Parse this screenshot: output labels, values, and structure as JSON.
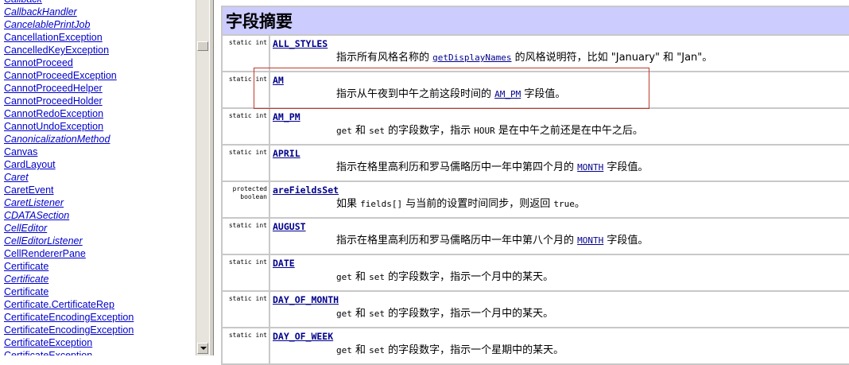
{
  "class_list": [
    {
      "label": "Callback",
      "italic": true
    },
    {
      "label": "CallbackHandler",
      "italic": true
    },
    {
      "label": "CancelablePrintJob",
      "italic": true
    },
    {
      "label": "CancellationException",
      "italic": false
    },
    {
      "label": "CancelledKeyException",
      "italic": false
    },
    {
      "label": "CannotProceed",
      "italic": false
    },
    {
      "label": "CannotProceedException",
      "italic": false
    },
    {
      "label": "CannotProceedHelper",
      "italic": false
    },
    {
      "label": "CannotProceedHolder",
      "italic": false
    },
    {
      "label": "CannotRedoException",
      "italic": false
    },
    {
      "label": "CannotUndoException",
      "italic": false
    },
    {
      "label": "CanonicalizationMethod",
      "italic": true
    },
    {
      "label": "Canvas",
      "italic": false
    },
    {
      "label": "CardLayout",
      "italic": false
    },
    {
      "label": "Caret",
      "italic": true
    },
    {
      "label": "CaretEvent",
      "italic": false
    },
    {
      "label": "CaretListener",
      "italic": true
    },
    {
      "label": "CDATASection",
      "italic": true
    },
    {
      "label": "CellEditor",
      "italic": true
    },
    {
      "label": "CellEditorListener",
      "italic": true
    },
    {
      "label": "CellRendererPane",
      "italic": false
    },
    {
      "label": "Certificate",
      "italic": false
    },
    {
      "label": "Certificate",
      "italic": true
    },
    {
      "label": "Certificate",
      "italic": false
    },
    {
      "label": "Certificate.CertificateRep",
      "italic": false
    },
    {
      "label": "CertificateEncodingException",
      "italic": false
    },
    {
      "label": "CertificateEncodingException",
      "italic": false
    },
    {
      "label": "CertificateException",
      "italic": false
    },
    {
      "label": "CertificateException",
      "italic": false
    }
  ],
  "summary": {
    "heading": "字段摘要",
    "rows": [
      {
        "modifier": "static int",
        "name": "ALL_STYLES",
        "desc": [
          {
            "t": "指示所有风格名称的 "
          },
          {
            "l": "getDisplayNames"
          },
          {
            "t": " 的风格说明符，比如 \"January\" 和 \"Jan\"。"
          }
        ]
      },
      {
        "modifier": "static int",
        "name": "AM",
        "desc": [
          {
            "t": "指示从午夜到中午之前这段时间的 "
          },
          {
            "l": "AM_PM"
          },
          {
            "t": " 字段值。"
          }
        ]
      },
      {
        "modifier": "static int",
        "name": "AM_PM",
        "desc": [
          {
            "c": "get"
          },
          {
            "t": " 和 "
          },
          {
            "c": "set"
          },
          {
            "t": " 的字段数字，指示 "
          },
          {
            "c": "HOUR"
          },
          {
            "t": " 是在中午之前还是在中午之后。"
          }
        ]
      },
      {
        "modifier": "static int",
        "name": "APRIL",
        "desc": [
          {
            "t": "指示在格里高利历和罗马儒略历中一年中第四个月的 "
          },
          {
            "l": "MONTH"
          },
          {
            "t": " 字段值。"
          }
        ]
      },
      {
        "modifier": "protected boolean",
        "name": "areFieldsSet",
        "desc": [
          {
            "t": "如果 "
          },
          {
            "c": "fields[]"
          },
          {
            "t": " 与当前的设置时间同步，则返回 "
          },
          {
            "c": "true"
          },
          {
            "t": "。"
          }
        ]
      },
      {
        "modifier": "static int",
        "name": "AUGUST",
        "desc": [
          {
            "t": "指示在格里高利历和罗马儒略历中一年中第八个月的 "
          },
          {
            "l": "MONTH"
          },
          {
            "t": " 字段值。"
          }
        ]
      },
      {
        "modifier": "static int",
        "name": "DATE",
        "desc": [
          {
            "c": "get"
          },
          {
            "t": " 和 "
          },
          {
            "c": "set"
          },
          {
            "t": " 的字段数字，指示一个月中的某天。"
          }
        ]
      },
      {
        "modifier": "static int",
        "name": "DAY_OF_MONTH",
        "desc": [
          {
            "c": "get"
          },
          {
            "t": " 和 "
          },
          {
            "c": "set"
          },
          {
            "t": " 的字段数字，指示一个月中的某天。"
          }
        ]
      },
      {
        "modifier": "static int",
        "name": "DAY_OF_WEEK",
        "desc": [
          {
            "c": "get"
          },
          {
            "t": " 和 "
          },
          {
            "c": "set"
          },
          {
            "t": " 的字段数字，指示一个星期中的某天。"
          }
        ]
      }
    ]
  },
  "colors": {
    "header_bg": "#ccccff",
    "link": "#00008b",
    "highlight": "#c0392b"
  }
}
